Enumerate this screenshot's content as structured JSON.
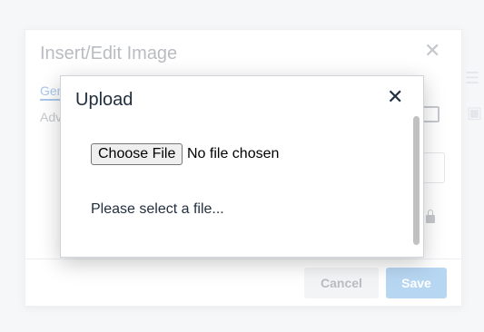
{
  "background_dialog": {
    "title": "Insert/Edit Image",
    "close_glyph": "✕",
    "tabs": [
      {
        "label": "Gen"
      },
      {
        "label": "Adv"
      }
    ],
    "cancel_label": "Cancel",
    "save_label": "Save"
  },
  "upload_dialog": {
    "title": "Upload",
    "close_glyph": "✕",
    "choose_file_label": "Choose File",
    "file_status": "No file chosen",
    "message": "Please select a file..."
  },
  "colors": {
    "primary_disabled": "#b7d6f2",
    "text_dark": "#222f3e"
  },
  "icons": {
    "editor_right_1": "menu-lines-icon",
    "editor_right_2": "image-icon",
    "browse": "upload-browse-icon",
    "lock": "lock-icon"
  }
}
